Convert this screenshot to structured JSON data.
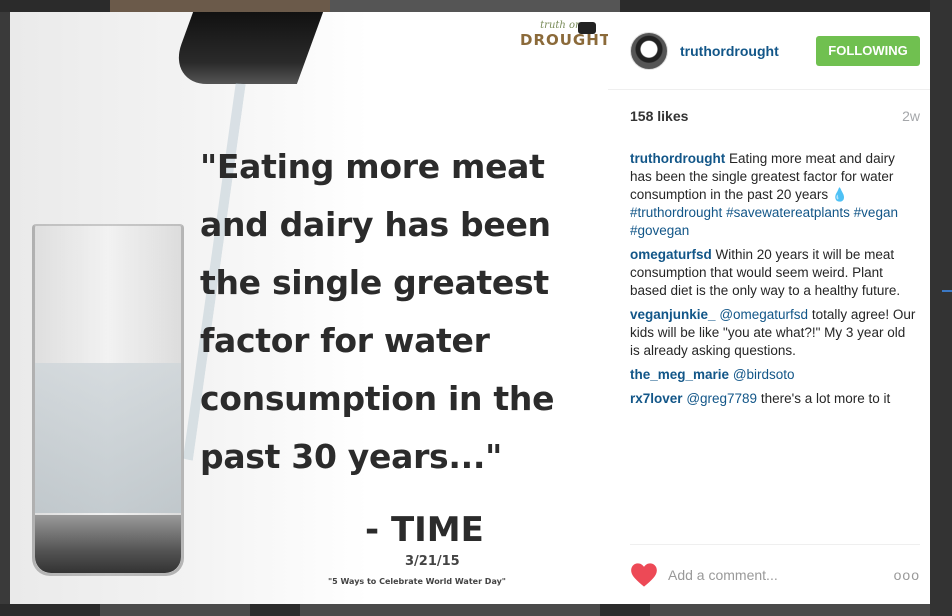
{
  "post": {
    "username": "truthordrought",
    "follow_label": "FOLLOWING",
    "likes": "158 likes",
    "age": "2w",
    "caption": {
      "user": "truthordrought",
      "text": "Eating more meat and dairy has been the single greatest factor for water consumption in the past 20 years",
      "icon": "droplet-icon",
      "tags": [
        "#truthordrought",
        "#savewatereatplants",
        "#vegan",
        "#govegan"
      ]
    }
  },
  "photo": {
    "logo_line1": "truth or",
    "logo_line2": "DROUGHT",
    "quote": "\"Eating more meat\nand dairy has been\nthe single greatest\nfactor for water\nconsumption in the\npast 30 years...\"",
    "attribution": "- TIME",
    "date": "3/21/15",
    "article_title": "\"5 Ways to Celebrate World Water Day\""
  },
  "comments": [
    {
      "user": "omegaturfsd",
      "mention": "",
      "text": "Within 20 years it will be meat consumption that would seem weird. Plant based diet is the only way to a healthy future."
    },
    {
      "user": "veganjunkie_",
      "mention": "@omegaturfsd",
      "text": "totally agree! Our kids will be like \"you ate what?!\" My 3 year old is already asking questions."
    },
    {
      "user": "the_meg_marie",
      "mention": "@birdsoto",
      "text": ""
    },
    {
      "user": "rx7lover",
      "mention": "@greg7789",
      "text": "there's a lot more to it"
    }
  ],
  "footer": {
    "comment_placeholder": "Add a comment...",
    "more_label": "ooo"
  },
  "colors": {
    "link": "#125688",
    "follow_button": "#70c050",
    "heart": "#ed4956"
  }
}
